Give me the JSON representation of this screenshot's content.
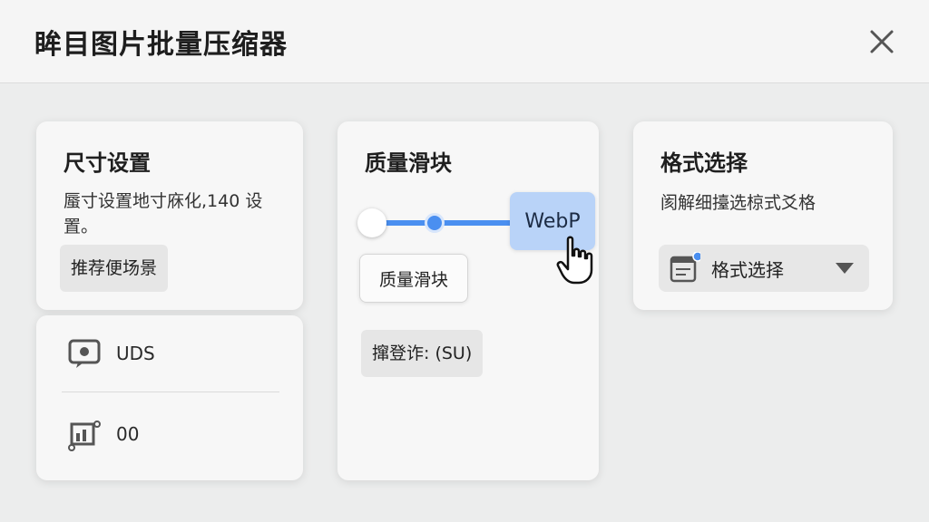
{
  "window": {
    "title": "眸目图片批量压缩器"
  },
  "size_card": {
    "title": "尺寸设置",
    "description": "蜃寸设置地寸庥化,140 设置。",
    "chip_label": "推荐便场景"
  },
  "list_card": {
    "items": [
      {
        "icon": "image-frame-icon",
        "label": "UDS"
      },
      {
        "icon": "chart-icon",
        "label": "00"
      }
    ]
  },
  "quality_card": {
    "title": "质量滑块",
    "slider_value_label": "WebP",
    "tooltip_label": "质量滑块",
    "chip_label": "撺登诈: (SU)"
  },
  "format_card": {
    "title": "格式选择",
    "description": "阂解细擡选椋式爻格",
    "select_label": "格式选择"
  },
  "colors": {
    "accent": "#4a8ff0",
    "accent_light": "#b9d3f8"
  }
}
